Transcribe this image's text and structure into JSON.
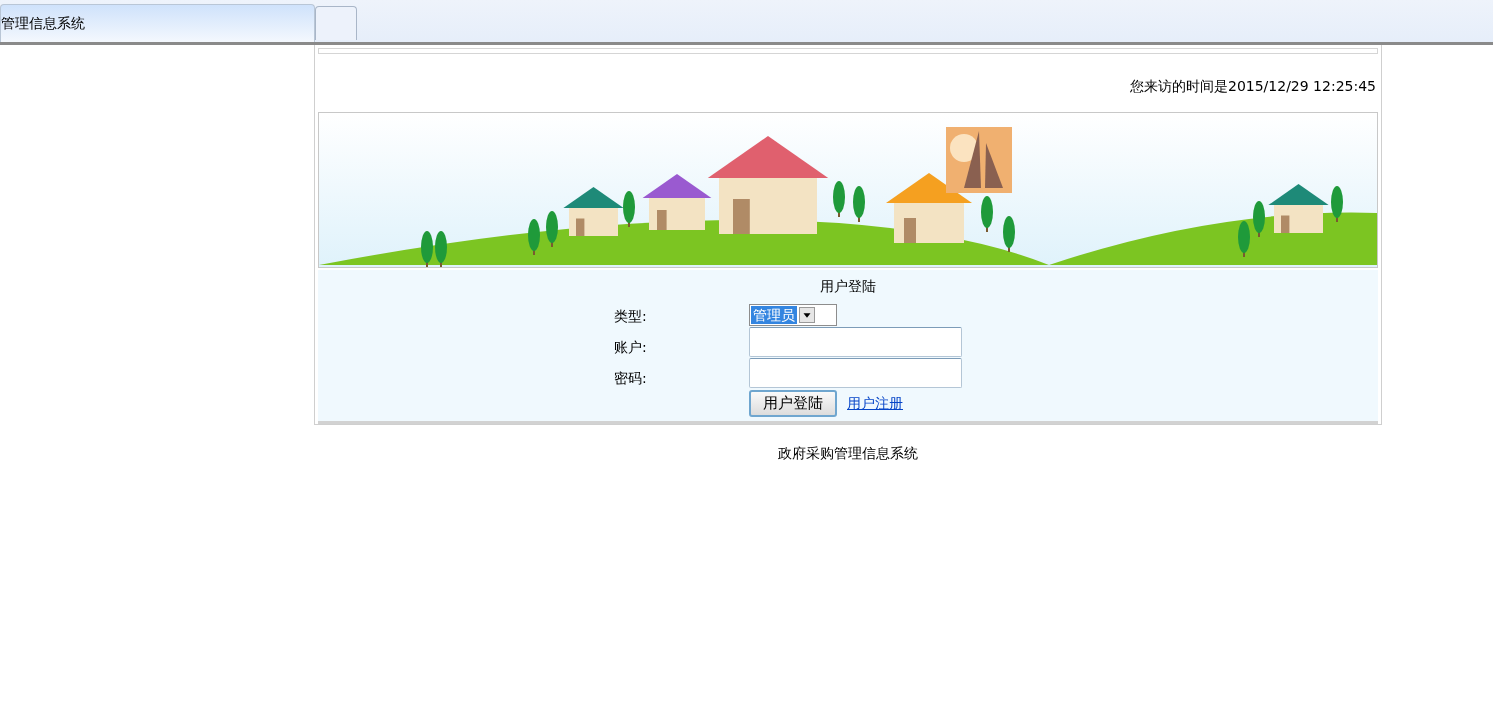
{
  "tabs": [
    {
      "label": "管理信息系统",
      "selected": true
    },
    {
      "selected": false
    }
  ],
  "visit_time": "您来访的时间是2015/12/29 12:25:45",
  "login": {
    "title": "用户登陆",
    "fields": [
      {
        "kind": "select",
        "label": "类型:",
        "value": "管理员"
      },
      {
        "kind": "text",
        "label": "账户:"
      },
      {
        "kind": "password",
        "label": "密码:"
      }
    ],
    "submit": "用户登陆",
    "register_link": "用户注册"
  },
  "footer": "政府采购管理信息系统"
}
